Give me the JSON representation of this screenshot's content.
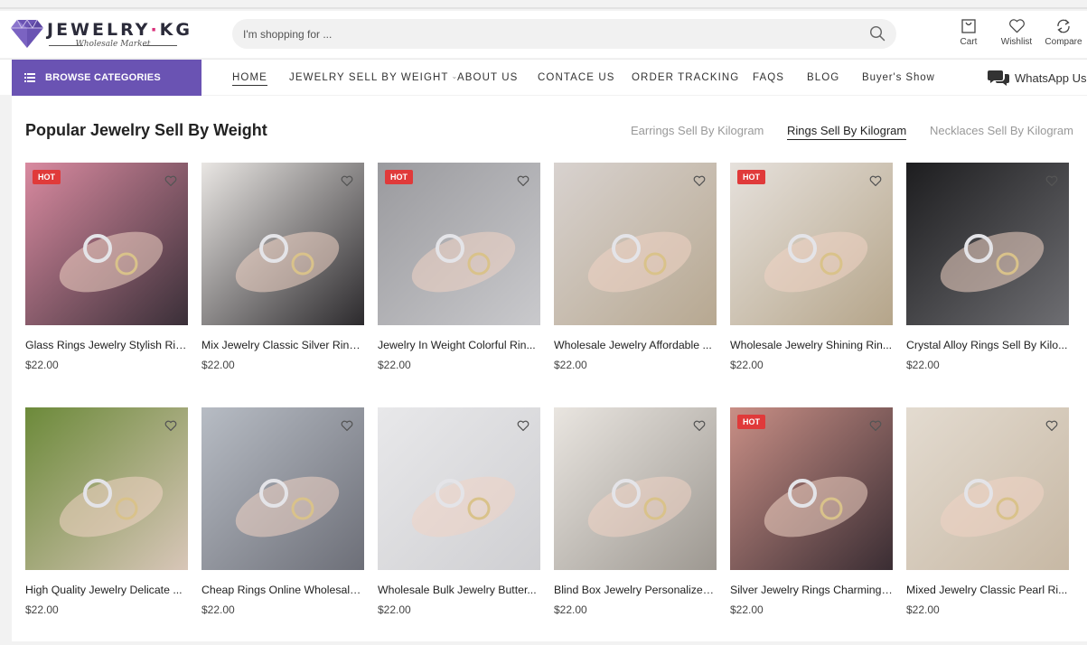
{
  "brand": {
    "name_left": "JEWELRY",
    "name_dot": "·",
    "name_right": "KG",
    "tagline": "Wholesale Market"
  },
  "search": {
    "placeholder": "I'm shopping for ..."
  },
  "header_actions": [
    {
      "label": "Cart",
      "icon": "cart-icon"
    },
    {
      "label": "Wishlist",
      "icon": "heart-icon"
    },
    {
      "label": "Compare",
      "icon": "compare-icon"
    }
  ],
  "nav": {
    "browse_label": "BROWSE CATEGORIES",
    "links": [
      "HOME",
      "JEWELRY SELL BY WEIGHT",
      "ABOUT US",
      "CONTACE US",
      "ORDER TRACKING",
      "FAQS",
      "BLOG",
      "Buyer's Show"
    ],
    "active": "HOME",
    "whatsapp": "WhatsApp Us"
  },
  "section": {
    "title": "Popular Jewelry Sell By Weight",
    "tabs": [
      "Earrings Sell By Kilogram",
      "Rings Sell By Kilogram",
      "Necklaces Sell By Kilogram"
    ],
    "active_tab": "Rings Sell By Kilogram"
  },
  "products": [
    {
      "name": "Glass Rings Jewelry Stylish Rin...",
      "price": "$22.00",
      "hot": "HOT"
    },
    {
      "name": "Mix Jewelry Classic Silver Ring...",
      "price": "$22.00",
      "hot": ""
    },
    {
      "name": "Jewelry In Weight Colorful Rin...",
      "price": "$22.00",
      "hot": "HOT"
    },
    {
      "name": "Wholesale Jewelry Affordable ...",
      "price": "$22.00",
      "hot": ""
    },
    {
      "name": "Wholesale Jewelry Shining Rin...",
      "price": "$22.00",
      "hot": "HOT"
    },
    {
      "name": "Crystal Alloy Rings Sell By Kilo...",
      "price": "$22.00",
      "hot": ""
    },
    {
      "name": "High Quality Jewelry Delicate ...",
      "price": "$22.00",
      "hot": ""
    },
    {
      "name": "Cheap Rings Online Wholesale...",
      "price": "$22.00",
      "hot": ""
    },
    {
      "name": "Wholesale Bulk Jewelry Butter...",
      "price": "$22.00",
      "hot": ""
    },
    {
      "name": "Blind Box Jewelry Personalized...",
      "price": "$22.00",
      "hot": ""
    },
    {
      "name": "Silver Jewelry Rings Charming ...",
      "price": "$22.00",
      "hot": "HOT"
    },
    {
      "name": "Mixed Jewelry Classic Pearl Ri...",
      "price": "$22.00",
      "hot": ""
    }
  ],
  "colors": {
    "accent": "#6a53b3",
    "hot": "#e03a3a",
    "brand_dot": "#d9307a"
  }
}
